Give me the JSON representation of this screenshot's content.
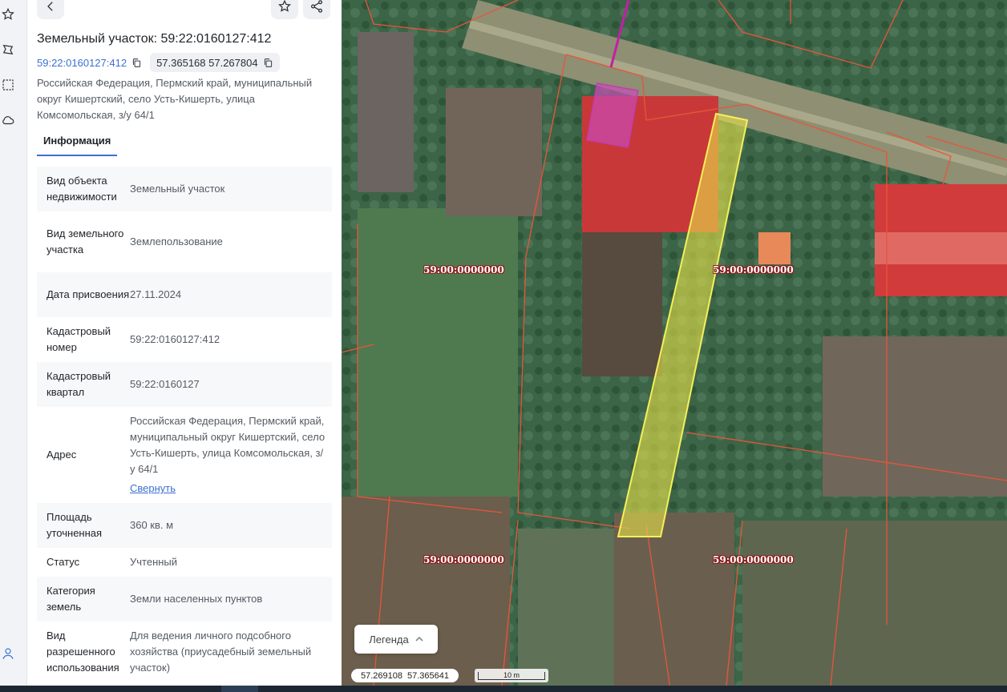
{
  "panel": {
    "title": "Земельный участок: 59:22:0160127:412",
    "cadastral_link": "59:22:0160127:412",
    "coords_chip": "57.365168 57.267804",
    "address": "Российская Федерация, Пермский край, муниципальный округ Кишертский, село Усть-Кишерть, улица Комсомольская, з/у 64/1",
    "tab": "Информация",
    "rows": [
      {
        "k": "Вид объекта недвижимости",
        "v": "Земельный участок"
      },
      {
        "k": "Вид земельного участка",
        "v": "Землепользование"
      },
      {
        "k": "Дата присвоения",
        "v": "27.11.2024"
      },
      {
        "k": "Кадастровый номер",
        "v": "59:22:0160127:412"
      },
      {
        "k": "Кадастровый квартал",
        "v": "59:22:0160127"
      },
      {
        "k": "Адрес",
        "v": "Российская Федерация, Пермский край, муниципальный округ Кишертский, село Усть-Кишерть, улица Комсомольская, з/у 64/1",
        "link": "Свернуть"
      },
      {
        "k": "Площадь уточненная",
        "v": "360 кв. м"
      },
      {
        "k": "Статус",
        "v": "Учтенный"
      },
      {
        "k": "Категория земель",
        "v": "Земли населенных пунктов"
      },
      {
        "k": "Вид разрешенного использования",
        "v": "Для ведения личного подсобного хозяйства (приусадебный земельный участок)"
      }
    ]
  },
  "map": {
    "cad_labels": [
      "59:00:0000000",
      "59:00:0000000",
      "59:00:0000000",
      "59:00:0000000"
    ],
    "legend_label": "Легенда",
    "coords": [
      "57.269108",
      "57.365641"
    ],
    "scale_label": "10 m"
  },
  "icons": {
    "rail": [
      "star-icon",
      "map-polygon-icon",
      "selection-icon",
      "cloud-icon",
      "user-icon"
    ],
    "toolbar": [
      "chevron-left-icon",
      "star-icon",
      "share-icon"
    ]
  }
}
